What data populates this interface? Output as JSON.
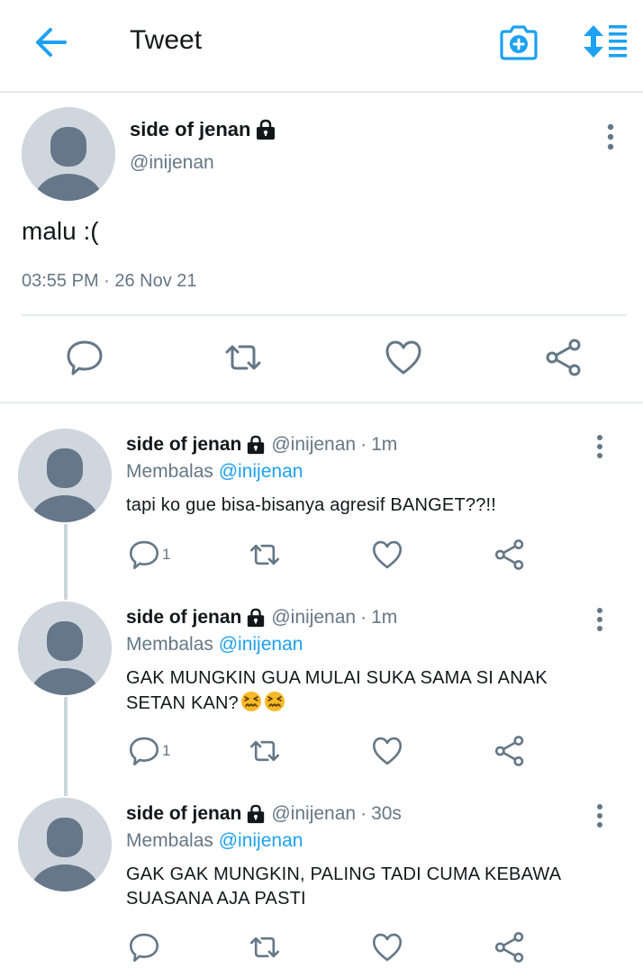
{
  "header": {
    "title": "Tweet",
    "back_icon": "arrow-left-icon",
    "camera_icon": "camera-add-icon",
    "sort_icon": "sort-list-icon",
    "accent": "#1da1f2"
  },
  "main_tweet": {
    "name": "side of jenan",
    "handle": "@inijenan",
    "text": "malu :(",
    "timestamp": "03:55 PM · 26 Nov 21",
    "locked": true
  },
  "replies": [
    {
      "name": "side of jenan",
      "handle": "@inijenan",
      "time": "1m",
      "reply_prefix": "Membalas",
      "reply_to": "@inijenan",
      "text": "tapi ko gue bisa-bisanya agresif BANGET??!!",
      "reply_count": "1"
    },
    {
      "name": "side of jenan",
      "handle": "@inijenan",
      "time": "1m",
      "reply_prefix": "Membalas",
      "reply_to": "@inijenan",
      "text_line1": "GAK MUNGKIN GUA MULAI SUKA SAMA SI ANAK",
      "text_line2": "SETAN KAN?",
      "emoji": "confounded-face-icon",
      "reply_count": "1"
    },
    {
      "name": "side of jenan",
      "handle": "@inijenan",
      "time": "30s",
      "reply_prefix": "Membalas",
      "reply_to": "@inijenan",
      "text_line1": "GAK GAK MUNGKIN, PALING TADI CUMA KEBAWA",
      "text_line2": "SUASANA AJA PASTI",
      "reply_count": ""
    }
  ],
  "colors": {
    "text": "#14171a",
    "muted": "#657786",
    "link": "#1da1f2",
    "icon": "#657786",
    "divider": "#e6e9eb",
    "avatar_bg": "#cfd6dd",
    "avatar_fg": "#66778a"
  }
}
